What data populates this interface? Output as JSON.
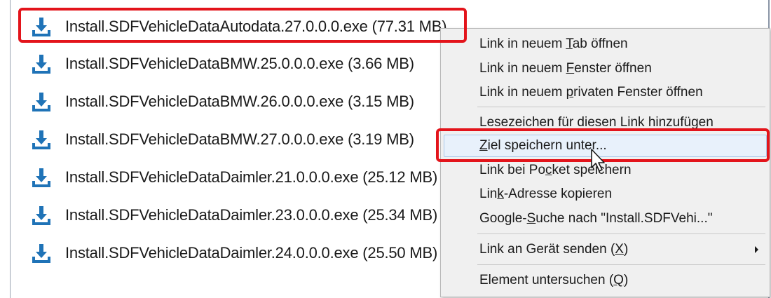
{
  "files": [
    {
      "name": "Install.SDFVehicleDataAutodata.27.0.0.0.exe (77.31 MB)"
    },
    {
      "name": "Install.SDFVehicleDataBMW.25.0.0.0.exe (3.66 MB)"
    },
    {
      "name": "Install.SDFVehicleDataBMW.26.0.0.0.exe (3.15 MB)"
    },
    {
      "name": "Install.SDFVehicleDataBMW.27.0.0.0.exe (3.19 MB)"
    },
    {
      "name": "Install.SDFVehicleDataDaimler.21.0.0.0.exe (25.12 MB)"
    },
    {
      "name": "Install.SDFVehicleDataDaimler.23.0.0.0.exe (25.34 MB)"
    },
    {
      "name": "Install.SDFVehicleDataDaimler.24.0.0.0.exe (25.50 MB)"
    }
  ],
  "context_menu": {
    "items": [
      {
        "pre": "Link in neuem ",
        "key": "T",
        "post": "ab öffnen"
      },
      {
        "pre": "Link in neuem ",
        "key": "F",
        "post": "enster öffnen"
      },
      {
        "pre": "Link in neuem ",
        "key": "p",
        "post": "rivaten Fenster öffnen"
      },
      {
        "pre": "Lesezeichen für diesen Link hinzufügen",
        "key": "",
        "post": ""
      },
      {
        "pre": "",
        "key": "Z",
        "post": "iel speichern unter..."
      },
      {
        "pre": "Link bei Po",
        "key": "c",
        "post": "ket speichern"
      },
      {
        "pre": "Lin",
        "key": "k",
        "post": "-Adresse kopieren"
      },
      {
        "pre": "Google-",
        "key": "S",
        "post": "uche nach \"Install.SDFVehi...\""
      },
      {
        "pre": "Link an Gerät senden (",
        "key": "X",
        "post": ")"
      },
      {
        "pre": "Element untersuchen (",
        "key": "Q",
        "post": ")"
      }
    ]
  },
  "colors": {
    "download_icon": "#1f73b7",
    "highlight": "#e3141b",
    "menu_background": "#f0f0f0",
    "menu_hover": "#e8f1fb"
  },
  "icons": {
    "file_icon": "download-icon",
    "submenu": "chevron-right-icon",
    "pointer": "mouse-cursor-icon"
  }
}
